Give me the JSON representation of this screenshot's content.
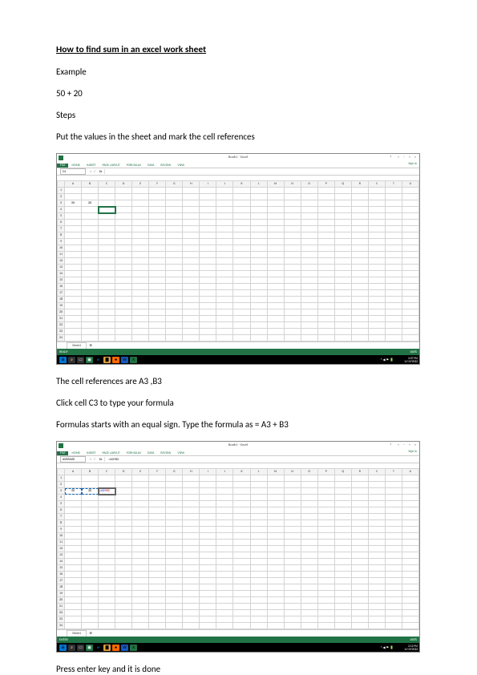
{
  "doc": {
    "title": "How to find sum in  an excel  work sheet",
    "example_label": "Example",
    "example_expr": "50 +  20",
    "steps_label": "Steps",
    "step1": "Put the values in the sheet and mark the cell references",
    "after1": "The cell references are A3 ,B3",
    "step2": "Click cell C3 to type your formula",
    "step3": "Formulas starts with an equal sign. Type the formula as = A3 + B3",
    "after2": "Press enter key and it is done"
  },
  "shot1": {
    "title": "Book1 - Excel",
    "signin": "Sign in",
    "tabs": [
      "FILE",
      "HOME",
      "INSERT",
      "PAGE LAYOUT",
      "FORMULAS",
      "DATA",
      "REVIEW",
      "VIEW"
    ],
    "namebox": "C4",
    "formula": "",
    "cols": [
      "A",
      "B",
      "C",
      "D",
      "E",
      "F",
      "G",
      "H",
      "I",
      "J",
      "K",
      "L",
      "M",
      "N",
      "O",
      "P",
      "Q",
      "R",
      "S",
      "T",
      "U"
    ],
    "rows": 24,
    "cells": {
      "A3": "50",
      "B3": "20"
    },
    "selected": "C4",
    "status": "READY",
    "sheet": "Sheet1",
    "zoom": "100%",
    "time": "2:07 PM",
    "date": "11/19/2022"
  },
  "shot2": {
    "title": "Book1 - Excel",
    "signin": "Sign in",
    "tabs": [
      "FILE",
      "HOME",
      "INSERT",
      "PAGE LAYOUT",
      "FORMULAS",
      "DATA",
      "REVIEW",
      "VIEW"
    ],
    "namebox": "AVERAGE",
    "formula": "=A3+B3",
    "cols": [
      "A",
      "B",
      "C",
      "D",
      "E",
      "F",
      "G",
      "H",
      "I",
      "J",
      "K",
      "L",
      "M",
      "N",
      "O",
      "P",
      "Q",
      "R",
      "S",
      "T",
      "U"
    ],
    "rows": 24,
    "cells": {
      "A3": "50",
      "B3": "20",
      "C3": "=A3+B3"
    },
    "editing": "C3",
    "dashed": [
      "A3",
      "B3"
    ],
    "status": "ENTER",
    "sheet": "Sheet1",
    "zoom": "100%",
    "time": "2:12 PM",
    "date": "11/19/2022"
  }
}
